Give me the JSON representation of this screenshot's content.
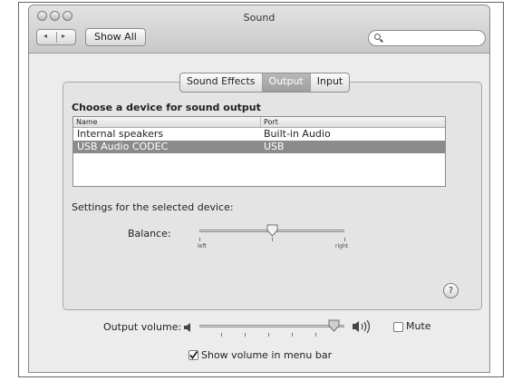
{
  "window": {
    "title": "Sound"
  },
  "toolbar": {
    "back_icon": "◂",
    "forward_icon": "▸",
    "show_all_label": "Show All",
    "search_placeholder": ""
  },
  "tabs": [
    {
      "label": "Sound Effects",
      "selected": false
    },
    {
      "label": "Output",
      "selected": true
    },
    {
      "label": "Input",
      "selected": false
    }
  ],
  "output": {
    "heading": "Choose a device for sound output",
    "columns": [
      "Name",
      "Port"
    ],
    "devices": [
      {
        "name": "Internal speakers",
        "port": "Built-in Audio",
        "selected": false
      },
      {
        "name": "USB Audio CODEC",
        "port": "USB",
        "selected": true
      }
    ],
    "settings_label": "Settings for the selected device:",
    "balance_label": "Balance:",
    "balance_left": "left",
    "balance_right": "right",
    "balance_value": 0.5
  },
  "help_label": "?",
  "volume": {
    "label": "Output volume:",
    "level": 0.93,
    "mute_label": "Mute",
    "mute_checked": false,
    "menu_bar_label": "Show volume in menu bar",
    "menu_bar_checked": true
  },
  "colors": {
    "selected_row": "#8b8b8b",
    "window_bg": "#ececec"
  }
}
